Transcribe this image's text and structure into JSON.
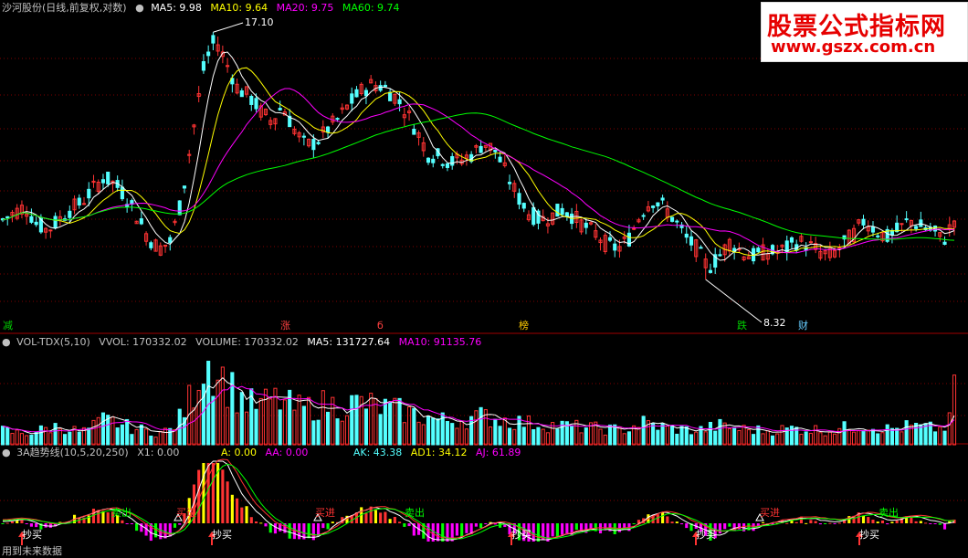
{
  "header_main": {
    "title": "沙河股份(日线,前复权,对数)",
    "ma5": "MA5: 9.98",
    "ma10": "MA10: 9.64",
    "ma20": "MA20: 9.75",
    "ma60": "MA60: 9.74"
  },
  "header_vol": {
    "name": "VOL-TDX(5,10)",
    "vvol": "VVOL: 170332.02",
    "volume": "VOLUME: 170332.02",
    "ma5": "MA5: 131727.64",
    "ma10": "MA10: 91135.76"
  },
  "header_ind": {
    "name": "3A趋势线(10,5,20,250)",
    "x1": "X1: 0.00",
    "a": "A: 0.00",
    "aa": "AA: 0.00",
    "ak": "AK: 43.38",
    "ad1": "AD1: 34.12",
    "aj": "AJ: 61.89"
  },
  "watermark": {
    "line1": "股票公式指标网",
    "line2": "www.gszx.com.cn"
  },
  "annotations": {
    "high": "17.10",
    "low": "8.32"
  },
  "events": [
    {
      "label": "减",
      "color": "#00d000"
    },
    {
      "label": "涨",
      "color": "#ff4040"
    },
    {
      "label": "б",
      "color": "#ff4040"
    },
    {
      "label": "榜",
      "color": "#ffcc00"
    },
    {
      "label": "跌",
      "color": "#00d000"
    },
    {
      "label": "财",
      "color": "#66ccff"
    }
  ],
  "signals": {
    "buy_label": "买进",
    "sell_label": "卖出",
    "bottom_label": "抄底",
    "buy": [
      "买进",
      "买进",
      "买进"
    ],
    "sell": [
      "卖出",
      "卖出",
      "卖出"
    ],
    "bottom": [
      "抄买",
      "抄买",
      "抄买",
      "抄买",
      "抄买"
    ]
  },
  "footer": "用到未来数据",
  "colors": {
    "up": "#ff3333",
    "down": "#54ffff",
    "ma5": "#ffffff",
    "ma10": "#ffff00",
    "ma20": "#ff00ff",
    "ma60": "#00ff00",
    "grid": "#800000"
  },
  "chart_data": [
    {
      "type": "candlestick",
      "title": "沙河股份(日线,前复权,对数)",
      "scale": "log",
      "y_range": [
        7.5,
        18
      ],
      "annotated_high": 17.1,
      "annotated_low": 8.32,
      "ma_last": {
        "MA5": 9.98,
        "MA10": 9.64,
        "MA20": 9.75,
        "MA60": 9.74
      },
      "close_path": [
        9.9,
        10.1,
        10.3,
        9.8,
        9.6,
        9.9,
        10.2,
        10.4,
        10.8,
        11.2,
        11.0,
        10.6,
        10.0,
        9.4,
        9.1,
        9.3,
        10.5,
        12.8,
        15.5,
        16.8,
        15.6,
        14.5,
        14.2,
        13.6,
        13.2,
        13.8,
        12.9,
        12.3,
        12.4,
        12.9,
        13.3,
        13.9,
        14.4,
        14.7,
        14.6,
        14.2,
        13.6,
        12.8,
        12.0,
        11.9,
        11.7,
        11.8,
        12.0,
        12.4,
        12.1,
        11.3,
        10.6,
        10.1,
        9.9,
        10.0,
        10.2,
        10.0,
        9.7,
        9.5,
        9.2,
        9.1,
        9.4,
        10.1,
        10.5,
        10.3,
        9.9,
        9.4,
        9.1,
        8.6,
        8.9,
        9.3,
        9.0,
        8.9,
        9.0,
        9.0,
        9.1,
        9.3,
        9.2,
        9.0,
        8.9,
        9.2,
        9.5,
        9.9,
        9.6,
        9.4,
        9.6,
        9.9,
        9.7,
        9.6,
        9.3,
        9.9
      ],
      "markers": [
        "减",
        "涨",
        "б",
        "榜",
        "跌",
        "财"
      ]
    },
    {
      "type": "bar",
      "title": "VOL-TDX(5,10)",
      "last": {
        "VVOL": 170332.02,
        "VOLUME": 170332.02,
        "MA5": 131727.64,
        "MA10": 91135.76
      },
      "y_range": [
        0,
        230000
      ],
      "volume_path": [
        35000,
        30000,
        28000,
        32000,
        40000,
        45000,
        38000,
        30000,
        42000,
        60000,
        55000,
        45000,
        38000,
        33000,
        30000,
        36000,
        70000,
        130000,
        210000,
        190000,
        150000,
        120000,
        100000,
        95000,
        110000,
        105000,
        90000,
        88000,
        95000,
        100000,
        92000,
        98000,
        102000,
        96000,
        90000,
        85000,
        80000,
        72000,
        66000,
        60000,
        58000,
        62000,
        65000,
        70000,
        64000,
        60000,
        56000,
        52000,
        50000,
        48000,
        46000,
        44000,
        42000,
        40000,
        38000,
        36000,
        40000,
        55000,
        48000,
        42000,
        38000,
        36000,
        34000,
        40000,
        46000,
        42000,
        38000,
        36000,
        34000,
        36000,
        38000,
        40000,
        38000,
        36000,
        35000,
        40000,
        45000,
        50000,
        42000,
        38000,
        40000,
        45000,
        42000,
        40000,
        38000,
        70000
      ]
    },
    {
      "type": "area",
      "title": "3A趋势线(10,5,20,250)",
      "last": {
        "X1": 0.0,
        "A": 0.0,
        "AA": 0.0,
        "AK": 43.38,
        "AD1": 34.12,
        "AJ": 61.89
      }
    }
  ]
}
